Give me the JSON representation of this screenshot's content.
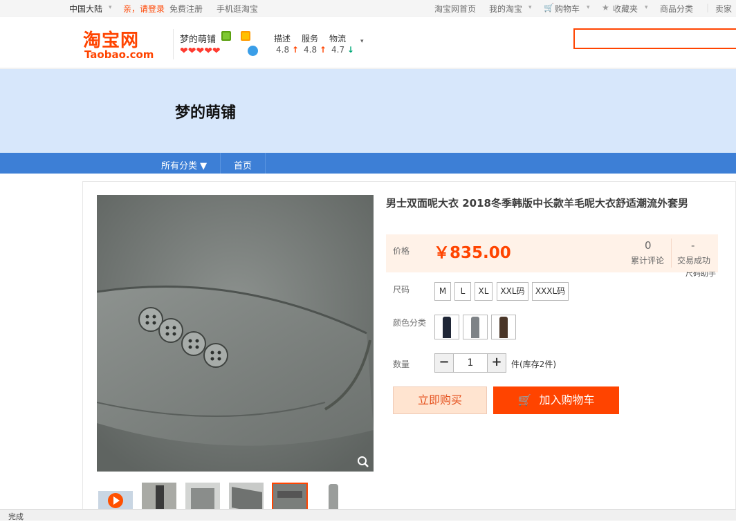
{
  "topbar": {
    "region": "中国大陆",
    "login": "亲，请登录",
    "register": "免费注册",
    "mobile": "手机逛淘宝",
    "home": "淘宝网首页",
    "my_taobao": "我的淘宝",
    "cart": "购物车",
    "favorites": "收藏夹",
    "categories": "商品分类",
    "seller": "卖家"
  },
  "logo": {
    "cn": "淘宝网",
    "en": "Taobao.com"
  },
  "shop": {
    "name": "梦的萌铺",
    "hearts": "❤❤❤❤❤",
    "ratings": [
      {
        "label": "描述",
        "value": "4.8",
        "trend": "↑"
      },
      {
        "label": "服务",
        "value": "4.8",
        "trend": "↑"
      },
      {
        "label": "物流",
        "value": "4.7",
        "trend": "↓"
      }
    ]
  },
  "banner": {
    "title": "梦的萌铺"
  },
  "nav": {
    "all_categories": "所有分类",
    "home": "首页"
  },
  "product": {
    "title": "男士双面呢大衣 2018冬季韩版中长款羊毛呢大衣舒适潮流外套男",
    "price_label": "价格",
    "price": "￥835.00",
    "reviews_count": "0",
    "reviews_label": "累计评论",
    "sales_count": "-",
    "sales_label": "交易成功",
    "size_helper": "尺码助手",
    "size_label": "尺码",
    "sizes": [
      "M",
      "L",
      "XL",
      "XXL码",
      "XXXL码"
    ],
    "color_label": "颜色分类",
    "qty_label": "数量",
    "qty_minus": "−",
    "qty_value": "1",
    "qty_plus": "+",
    "stock_text": "件(库存2件)",
    "buy_now": "立即购买",
    "add_to_cart": "加入购物车"
  },
  "status": {
    "text": "完成"
  },
  "colors": {
    "accent": "#ff4400",
    "nav": "#3d7fd6",
    "banner": "#d7e7fb"
  }
}
